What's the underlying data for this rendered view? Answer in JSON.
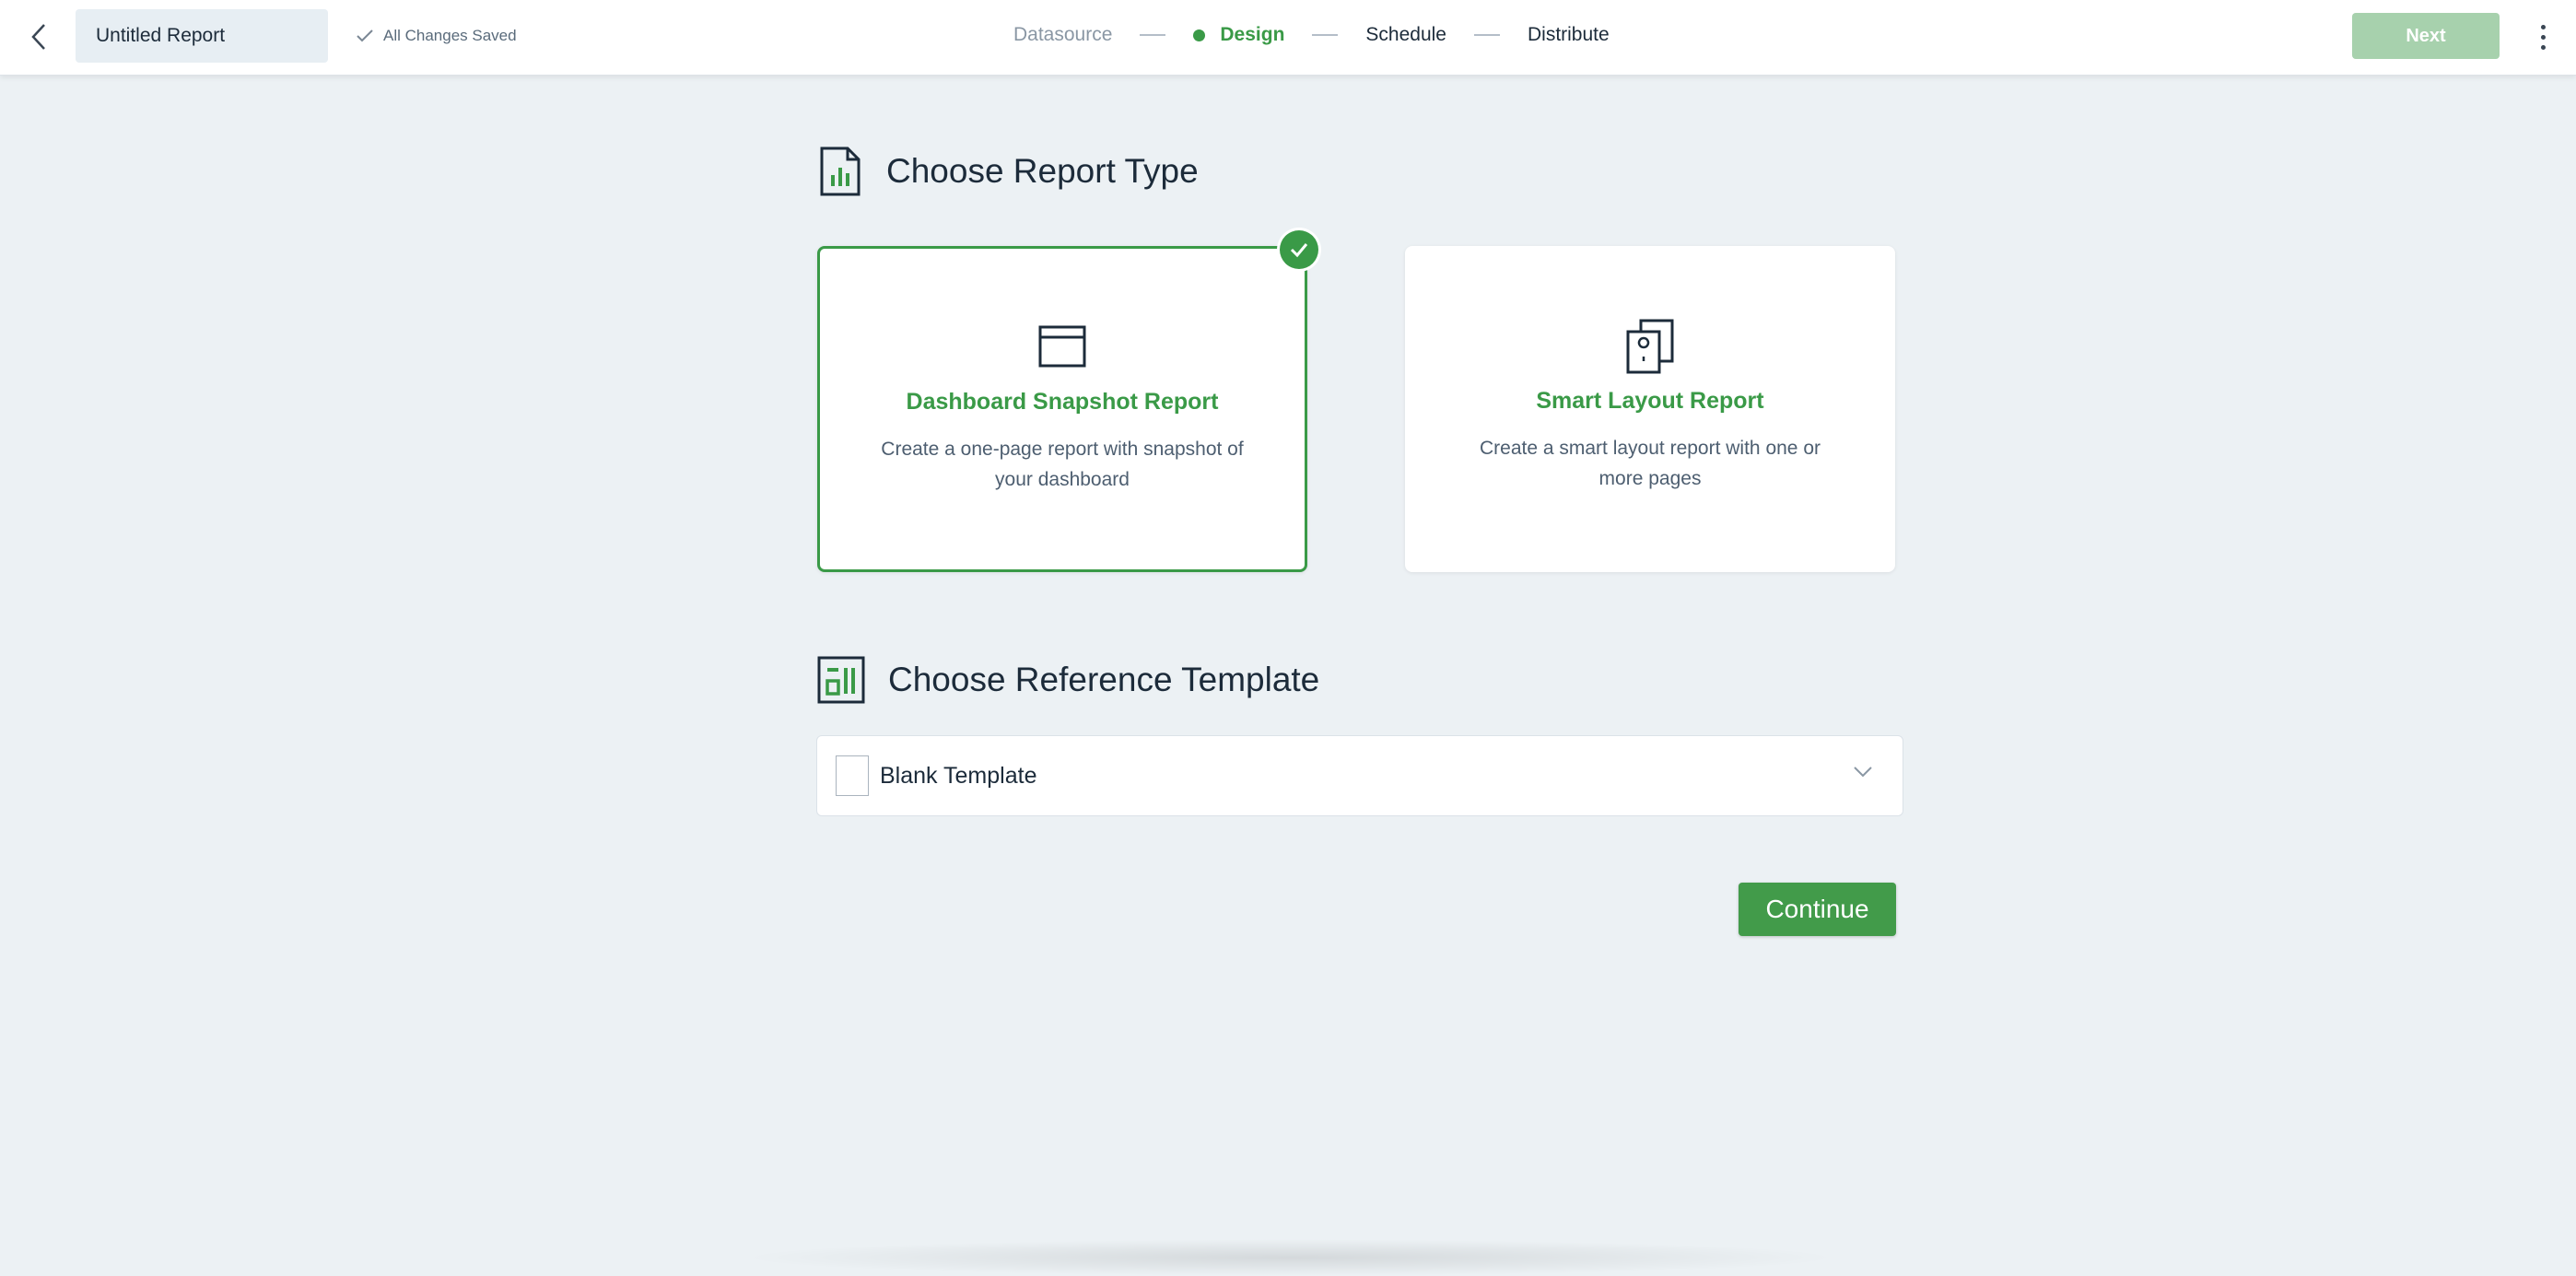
{
  "header": {
    "report_title": "Untitled Report",
    "save_status": "All Changes Saved",
    "next_label": "Next",
    "steps": [
      {
        "label": "Datasource",
        "state": "done"
      },
      {
        "label": "Design",
        "state": "active"
      },
      {
        "label": "Schedule",
        "state": "pending"
      },
      {
        "label": "Distribute",
        "state": "pending"
      }
    ]
  },
  "report_type": {
    "heading": "Choose Report Type",
    "cards": [
      {
        "title": "Dashboard Snapshot Report",
        "description": "Create a one-page report with snapshot of your dashboard",
        "selected": true,
        "icon": "browser-window-icon"
      },
      {
        "title": "Smart Layout Report",
        "description": "Create a smart layout report with one or more pages",
        "selected": false,
        "icon": "stacked-pages-icon"
      }
    ]
  },
  "reference_template": {
    "heading": "Choose Reference Template",
    "selected": "Blank Template"
  },
  "continue_label": "Continue",
  "colors": {
    "accent": "#3a9a47",
    "background": "#ecf1f4",
    "next_disabled": "#a7d1ad"
  }
}
